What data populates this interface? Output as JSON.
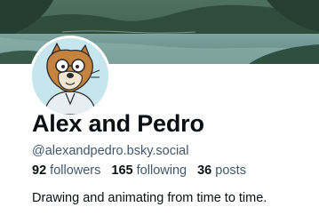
{
  "profile": {
    "display_name": "Alex and Pedro",
    "handle": "@alexandpedro.bsky.social",
    "bio": "Drawing and animating from time to time."
  },
  "stats": {
    "followers_count": "92",
    "followers_label": "followers",
    "following_count": "165",
    "following_label": "following",
    "posts_count": "36",
    "posts_label": "posts"
  },
  "images": {
    "banner": "mountain-lake-banner",
    "avatar": "cartoon-fox-with-glasses-avatar"
  },
  "colors": {
    "text_primary": "#0b0f14",
    "text_secondary": "#42576c",
    "avatar_bg": "#bfe3ec"
  }
}
